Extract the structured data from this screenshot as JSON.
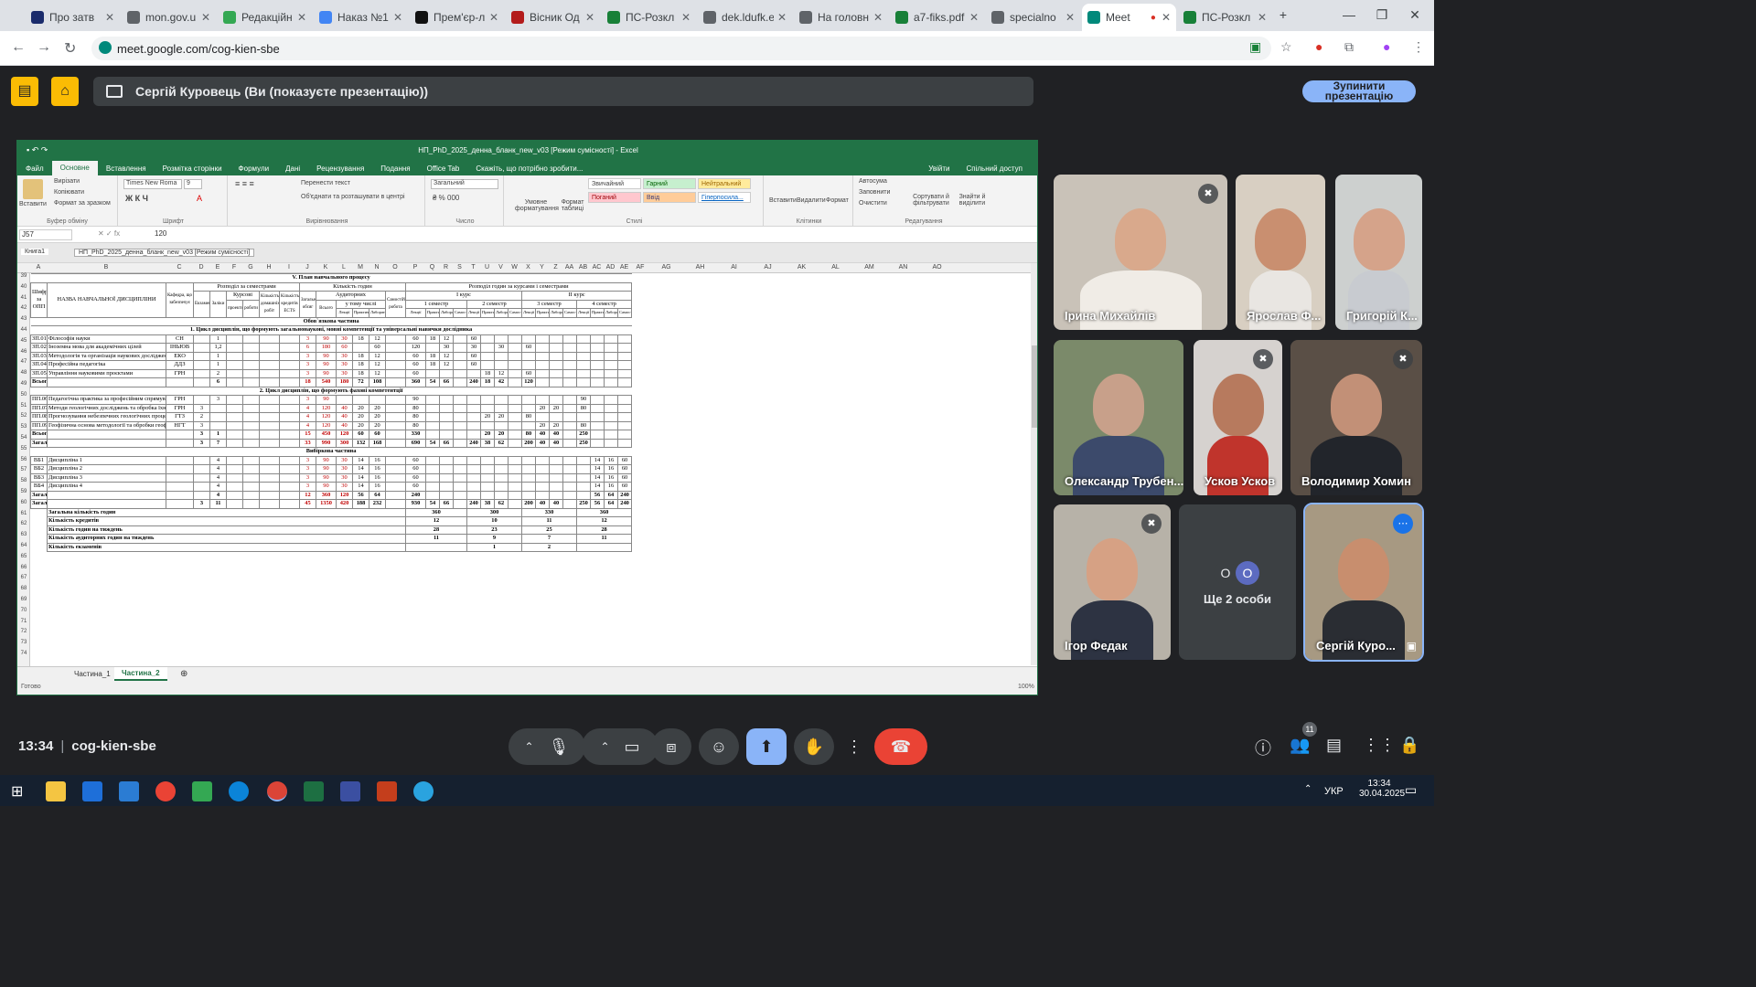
{
  "browser": {
    "tabs": [
      {
        "title": "Про затв",
        "color": "#1a2b6b"
      },
      {
        "title": "mon.gov.u",
        "color": "#5f6368"
      },
      {
        "title": "Редакційн",
        "color": "#34a853"
      },
      {
        "title": "Наказ №1",
        "color": "#4285f4"
      },
      {
        "title": "Прем'єр-л",
        "color": "#111111"
      },
      {
        "title": "Вісник Од",
        "color": "#b31b1b"
      },
      {
        "title": "ПС-Розкл",
        "color": "#188038"
      },
      {
        "title": "dek.ldufk.e",
        "color": "#5f6368"
      },
      {
        "title": "На головн",
        "color": "#5f6368"
      },
      {
        "title": "a7-fiks.pdf",
        "color": "#188038"
      },
      {
        "title": "specialno",
        "color": "#5f6368"
      },
      {
        "title": "Meet",
        "color": "#00897b"
      },
      {
        "title": "ПС-Розкл",
        "color": "#188038"
      }
    ],
    "url": "meet.google.com/cog-kien-sbe"
  },
  "presenting": {
    "banner": "Сергій Куровець (Ви (показуєте презентацію))",
    "stop_button": "Зупинити презентацію"
  },
  "excel": {
    "window_title": "НП_PhD_2025_денна_бланк_new_v03 [Режим сумісності] - Excel",
    "menu": [
      "Файл",
      "Основне",
      "Вставлення",
      "Розмітка сторінки",
      "Формули",
      "Дані",
      "Рецензування",
      "Подання",
      "Office Tab",
      "Скажіть, що потрібно зробити..."
    ],
    "menu_right": [
      "Увійти",
      "Спільний доступ"
    ],
    "clipboard": {
      "paste": "Вставити",
      "cut": "Вирізати",
      "copy": "Копіювати",
      "format_painter": "Формат за зразком",
      "group": "Буфер обміну"
    },
    "font": {
      "name": "Times New Roma",
      "size": "9",
      "group": "Шрифт"
    },
    "alignment": {
      "wrap": "Перенести текст",
      "merge": "Об'єднати та розташувати в центрі",
      "group": "Вирівнювання"
    },
    "number": {
      "format": "Загальний",
      "group": "Число"
    },
    "styles": {
      "conditional": "Умовне форматування",
      "table": "Формат таблиці",
      "normal": "Звичайний",
      "good": "Гарний",
      "neutral": "Нейтральний",
      "bad": "Поганий",
      "input": "Ввід",
      "hyperlink": "Гіперпосила...",
      "group": "Стилі"
    },
    "cells": {
      "insert": "Вставити",
      "delete": "Видалити",
      "format": "Формат",
      "group": "Клітинки"
    },
    "editing": {
      "autosum": "Автосума",
      "fill": "Заповнити",
      "clear": "Очистити",
      "sort": "Сортувати й фільтрувати",
      "find": "Знайти й виділити",
      "group": "Редагування"
    },
    "name_box": "J57",
    "formula": "120",
    "sheet_tabs_top": [
      "Книга1",
      "НП_PhD_2025_денна_бланк_new_v03 [Режим сумісності]"
    ],
    "columns": [
      "A",
      "B",
      "C",
      "D",
      "E",
      "F",
      "G",
      "H",
      "I",
      "J",
      "K",
      "L",
      "M",
      "N",
      "O",
      "P",
      "Q",
      "R",
      "S",
      "T",
      "U",
      "V",
      "W",
      "X",
      "Y",
      "Z",
      "AA",
      "AB",
      "AC",
      "AD",
      "AE",
      "AF",
      "AG",
      "AH",
      "AI",
      "AJ",
      "AK",
      "AL",
      "AM",
      "AN",
      "AO"
    ],
    "row_numbers": [
      "39",
      "40",
      "41",
      "42",
      "43",
      "44",
      "45",
      "46",
      "47",
      "48",
      "49",
      "50",
      "51",
      "52",
      "53",
      "54",
      "55",
      "56",
      "57",
      "58",
      "59",
      "60",
      "61",
      "62",
      "63",
      "64",
      "65",
      "66",
      "67",
      "68",
      "69",
      "70",
      "71",
      "72",
      "73",
      "74"
    ],
    "section_title": "V. План навчального процесу",
    "header_labels": {
      "code": "Шифр за ОПП",
      "name": "НАЗВА НАВЧАЛЬНОЇ ДИСЦИПЛІНИ",
      "dept": "Кафедра, що забезпечує",
      "distribution": "Розподіл за семестрами",
      "exams": "Екзамени",
      "credits_tests": "Заліки",
      "coursework": "Курсові",
      "projects": "проекти",
      "works": "роботи",
      "indiv": "Кількість домашніх робіт",
      "ects": "Кількість кредитів ECTS",
      "hours": "Кількість годин",
      "total": "Загальний обсяг",
      "classroom": "Аудиторних",
      "all": "Всього",
      "incl": "у тому числі",
      "lectures": "Лекції",
      "practical": "Практичні",
      "lab": "Лабораторні",
      "self": "Самостійна робота",
      "distrib_courses": "Розподіл годин за курсами і семестрами",
      "course1": "І курс",
      "course2": "ІІ курс",
      "sem1": "1 семестр",
      "sem2": "2 семестр",
      "sem3": "3 семестр",
      "sem4": "4 семестр",
      "weeks13": "13 тижнів"
    },
    "blocks": {
      "mandatory": "Обов`язкова частина",
      "cycle1": "1. Цикл дисциплін, що формують загальнонаукові, мовні компетенції та універсальні навички дослідника",
      "cycle2": "2. Цикл дисциплін, що формують фахові компетентції",
      "elective": "Вибіркова частина"
    },
    "rows_cycle1": [
      [
        "ЗП.01",
        "Філософія науки",
        "СН",
        "",
        "1",
        "",
        "",
        "",
        "",
        "3",
        "90",
        "30",
        "18",
        "12",
        "",
        "60",
        "18",
        "12",
        "",
        "60",
        "",
        "",
        "",
        "",
        "",
        "",
        "",
        "",
        "",
        "",
        ""
      ],
      [
        "ЗП.02",
        "Іноземна мова для академічних цілей",
        "ІНЬЮВ",
        "",
        "1,2",
        "",
        "",
        "",
        "",
        "6",
        "180",
        "60",
        "",
        "60",
        "",
        "120",
        "",
        "30",
        "",
        "30",
        "",
        "30",
        "",
        "60",
        "",
        "",
        "",
        "",
        "",
        "",
        ""
      ],
      [
        "ЗП.03",
        "Методологія та організація наукових досліджень",
        "ЕКО",
        "",
        "1",
        "",
        "",
        "",
        "",
        "3",
        "90",
        "30",
        "18",
        "12",
        "",
        "60",
        "18",
        "12",
        "",
        "60",
        "",
        "",
        "",
        "",
        "",
        "",
        "",
        "",
        "",
        "",
        ""
      ],
      [
        "ЗП.04",
        "Професійна педагогіка",
        "ДДЗ",
        "",
        "1",
        "",
        "",
        "",
        "",
        "3",
        "90",
        "30",
        "18",
        "12",
        "",
        "60",
        "18",
        "12",
        "",
        "60",
        "",
        "",
        "",
        "",
        "",
        "",
        "",
        "",
        "",
        "",
        ""
      ],
      [
        "ЗП.05",
        "Управління науковими проєктами",
        "ГРН",
        "",
        "2",
        "",
        "",
        "",
        "",
        "3",
        "90",
        "30",
        "18",
        "12",
        "",
        "60",
        "",
        "",
        "",
        "",
        "18",
        "12",
        "",
        "60",
        "",
        "",
        "",
        "",
        "",
        "",
        ""
      ],
      [
        "Всього в циклі 1:",
        "",
        "",
        "",
        "6",
        "",
        "",
        "",
        "",
        "18",
        "540",
        "180",
        "72",
        "108",
        "",
        "360",
        "54",
        "66",
        "",
        "240",
        "18",
        "42",
        "",
        "120",
        "",
        "",
        "",
        "",
        "",
        "",
        ""
      ]
    ],
    "rows_cycle2": [
      [
        "ПП.06",
        "Педагогічна практика за професійним спрямуванням",
        "ГРН",
        "",
        "3",
        "",
        "",
        "",
        "",
        "3",
        "90",
        "",
        "",
        "",
        "",
        "90",
        "",
        "",
        "",
        "",
        "",
        "",
        "",
        "",
        "",
        "",
        "",
        "90",
        "",
        "",
        ""
      ],
      [
        "ПП.07",
        "Методи геологічних досліджень та обробка їхніх результатів",
        "ГРН",
        "3",
        "",
        "",
        "",
        "",
        "",
        "4",
        "120",
        "40",
        "20",
        "20",
        "",
        "80",
        "",
        "",
        "",
        "",
        "",
        "",
        "",
        "",
        "20",
        "20",
        "",
        "80",
        "",
        "",
        ""
      ],
      [
        "ПП.08",
        "Прогнозування небезпечних геологічних процесів",
        "ГТЗ",
        "2",
        "",
        "",
        "",
        "",
        "",
        "4",
        "120",
        "40",
        "20",
        "20",
        "",
        "80",
        "",
        "",
        "",
        "",
        "20",
        "20",
        "",
        "80",
        "",
        "",
        "",
        "",
        "",
        "",
        ""
      ],
      [
        "ПП.09",
        "Геофізична основа методології та обробки геофізичних даних",
        "НГТ",
        "3",
        "",
        "",
        "",
        "",
        "",
        "4",
        "120",
        "40",
        "20",
        "20",
        "",
        "80",
        "",
        "",
        "",
        "",
        "",
        "",
        "",
        "",
        "20",
        "20",
        "",
        "80",
        "",
        "",
        ""
      ],
      [
        "Всього в циклі 2:",
        "",
        "",
        "3",
        "1",
        "",
        "",
        "",
        "",
        "15",
        "450",
        "120",
        "60",
        "60",
        "",
        "330",
        "",
        "",
        "",
        "",
        "20",
        "20",
        "",
        "80",
        "40",
        "40",
        "",
        "250",
        "",
        "",
        ""
      ],
      [
        "Загальний обсяг обов`язкової частини:",
        "",
        "",
        "3",
        "7",
        "",
        "",
        "",
        "",
        "33",
        "990",
        "300",
        "132",
        "168",
        "",
        "690",
        "54",
        "66",
        "",
        "240",
        "38",
        "62",
        "",
        "200",
        "40",
        "40",
        "",
        "250",
        "",
        "",
        ""
      ]
    ],
    "rows_elective": [
      [
        "ВБ1",
        "Дисципліна 1",
        "",
        "",
        "4",
        "",
        "",
        "",
        "",
        "3",
        "90",
        "30",
        "14",
        "16",
        "",
        "60",
        "",
        "",
        "",
        "",
        "",
        "",
        "",
        "",
        "",
        "",
        "",
        "",
        "14",
        "16",
        "60"
      ],
      [
        "ВБ2",
        "Дисципліна 2",
        "",
        "",
        "4",
        "",
        "",
        "",
        "",
        "3",
        "90",
        "30",
        "14",
        "16",
        "",
        "60",
        "",
        "",
        "",
        "",
        "",
        "",
        "",
        "",
        "",
        "",
        "",
        "",
        "14",
        "16",
        "60"
      ],
      [
        "ВБ3",
        "Дисципліна 3",
        "",
        "",
        "4",
        "",
        "",
        "",
        "",
        "3",
        "90",
        "30",
        "14",
        "16",
        "",
        "60",
        "",
        "",
        "",
        "",
        "",
        "",
        "",
        "",
        "",
        "",
        "",
        "",
        "14",
        "16",
        "60"
      ],
      [
        "ВБ4",
        "Дисципліна 4",
        "",
        "",
        "4",
        "",
        "",
        "",
        "",
        "3",
        "90",
        "30",
        "14",
        "16",
        "",
        "60",
        "",
        "",
        "",
        "",
        "",
        "",
        "",
        "",
        "",
        "",
        "",
        "",
        "14",
        "16",
        "60"
      ],
      [
        "Загальний обсяг вибіркової частини:",
        "",
        "",
        "",
        "4",
        "",
        "",
        "",
        "",
        "12",
        "360",
        "120",
        "56",
        "64",
        "",
        "240",
        "",
        "",
        "",
        "",
        "",
        "",
        "",
        "",
        "",
        "",
        "",
        "",
        "56",
        "64",
        "240"
      ],
      [
        "Загальний обсяг навчального плану:",
        "",
        "",
        "3",
        "11",
        "",
        "",
        "",
        "",
        "45",
        "1350",
        "420",
        "188",
        "232",
        "",
        "930",
        "54",
        "66",
        "",
        "240",
        "38",
        "62",
        "",
        "200",
        "40",
        "40",
        "",
        "250",
        "56",
        "64",
        "240"
      ]
    ],
    "summary_rows": [
      {
        "label": "Загальна кількість годин",
        "values": [
          "360",
          "300",
          "330",
          "360"
        ]
      },
      {
        "label": "Кількість кредитів",
        "values": [
          "12",
          "10",
          "11",
          "12"
        ]
      },
      {
        "label": "Кількість годин на тиждень",
        "values": [
          "28",
          "23",
          "25",
          "28"
        ]
      },
      {
        "label": "Кількість аудиторних годин на тиждень",
        "values": [
          "11",
          "9",
          "7",
          "11"
        ]
      },
      {
        "label": "Кількість екзаменів",
        "values": [
          "",
          "1",
          "2",
          ""
        ]
      }
    ],
    "sheets": [
      "Частина_1",
      "Частина_2"
    ],
    "status_left": "Готово",
    "zoom": "100%"
  },
  "participants": [
    {
      "name": "Ірина Михайлів",
      "muted": true,
      "bg": "#c9c2b8",
      "skin": "#d9a98c",
      "shirt": "#f0ece6"
    },
    {
      "name": "Ярослав Ф...",
      "muted": false,
      "bg": "#d8cfc2",
      "skin": "#c98f70",
      "shirt": "#e9e6e2"
    },
    {
      "name": "Григорій К...",
      "muted": false,
      "bg": "#cdd0cf",
      "skin": "#d5a38a",
      "shirt": "#c8cbd0"
    },
    {
      "name": "Олександр Трубен...",
      "muted": false,
      "bg": "#7b8a6a",
      "skin": "#c8a08a",
      "shirt": "#3c4a6b"
    },
    {
      "name": "Усков Усков",
      "muted": true,
      "bg": "#d6d2cf",
      "skin": "#b77a5e",
      "shirt": "#c0342c"
    },
    {
      "name": "Володимир Хомин",
      "muted": true,
      "bg": "#5a4f46",
      "skin": "#c29077",
      "shirt": "#22252b"
    },
    {
      "name": "Ігор Федак",
      "muted": true,
      "bg": "#b7b2a8",
      "skin": "#d6a184",
      "shirt": "#2d3342"
    },
    {
      "name": "Сергій Куро...",
      "muted": false,
      "bg": "#a79982",
      "skin": "#c88e6e",
      "shirt": "#2a2d33"
    }
  ],
  "more_tile": {
    "label": "Ще 2 особи",
    "avatar1": "О",
    "avatar2": "О"
  },
  "meeting": {
    "time": "13:34",
    "code": "cog-kien-sbe",
    "participant_count": "11"
  },
  "taskbar": {
    "lang": "УКР",
    "time": "13:34",
    "date": "30.04.2025"
  }
}
